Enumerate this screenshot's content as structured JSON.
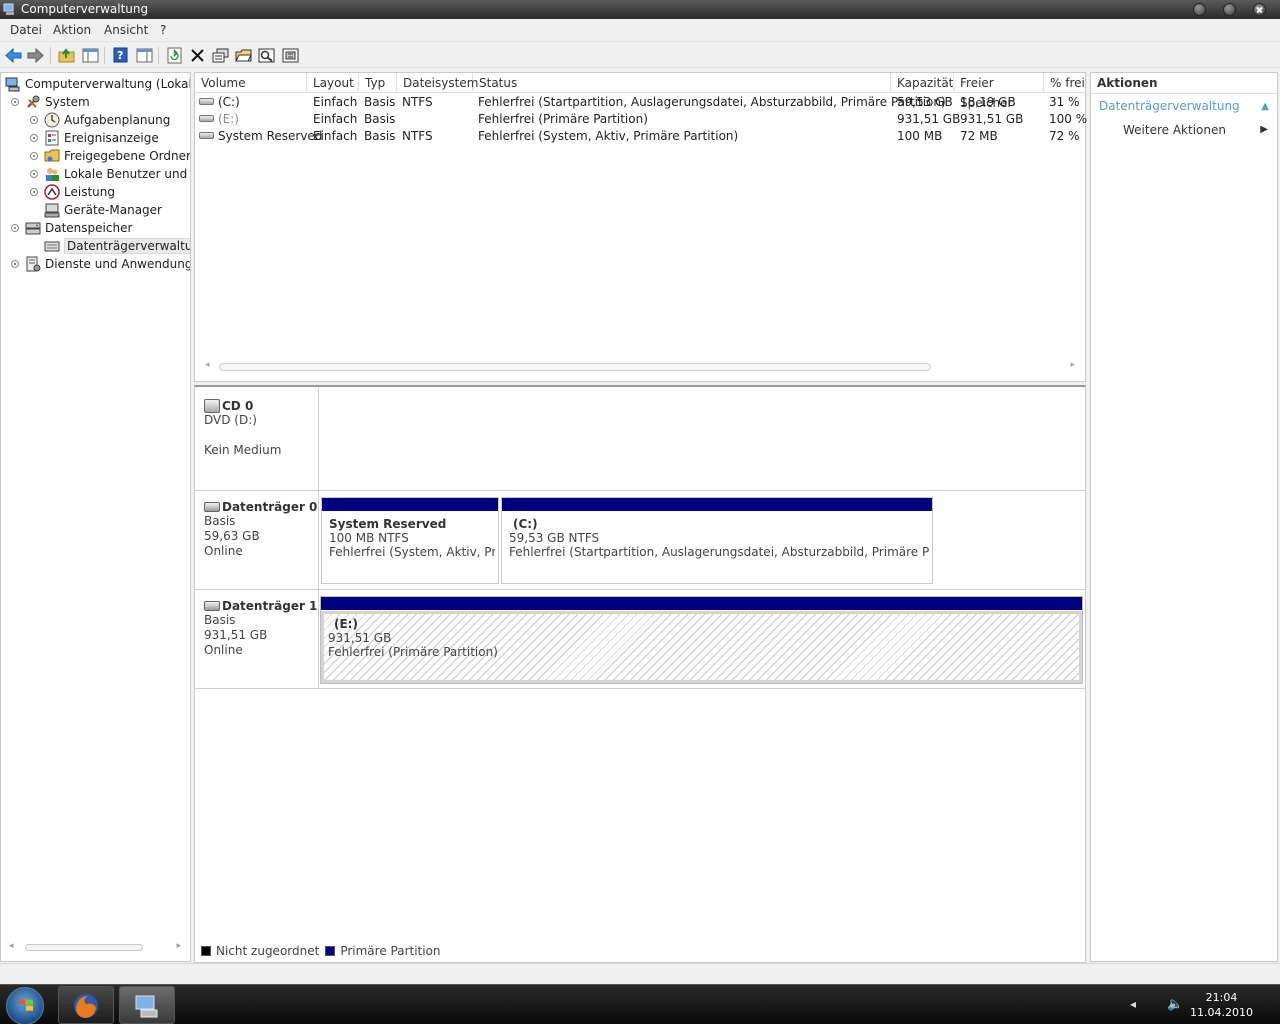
{
  "window": {
    "title": "Computerverwaltung"
  },
  "menu": [
    "Datei",
    "Aktion",
    "Ansicht",
    "?"
  ],
  "toolbar": {
    "buttons": [
      "back-icon",
      "forward-icon",
      "up-folder-icon",
      "show-hide-tree-icon",
      "help-icon",
      "properties-pane-icon",
      "refresh-icon",
      "delete-icon",
      "properties-icon",
      "open-icon",
      "search-icon",
      "export-icon"
    ]
  },
  "tree": {
    "root": "Computerverwaltung (Lokal)",
    "items": [
      {
        "label": "System",
        "level": 1,
        "icon": "tools-icon"
      },
      {
        "label": "Aufgabenplanung",
        "level": 2,
        "icon": "clock-icon"
      },
      {
        "label": "Ereignisanzeige",
        "level": 2,
        "icon": "event-viewer-icon"
      },
      {
        "label": "Freigegebene Ordner",
        "level": 2,
        "icon": "shared-folder-icon"
      },
      {
        "label": "Lokale Benutzer und Gruppen",
        "level": 2,
        "icon": "users-icon"
      },
      {
        "label": "Leistung",
        "level": 2,
        "icon": "performance-icon"
      },
      {
        "label": "Geräte-Manager",
        "level": 2,
        "icon": "device-manager-icon"
      },
      {
        "label": "Datenspeicher",
        "level": 1,
        "icon": "storage-icon"
      },
      {
        "label": "Datenträgerverwaltung",
        "level": 2,
        "icon": "disk-management-icon"
      },
      {
        "label": "Dienste und Anwendungen",
        "level": 1,
        "icon": "services-icon"
      }
    ]
  },
  "volumes": {
    "columns": [
      "Volume",
      "Layout",
      "Typ",
      "Dateisystem",
      "Status",
      "Kapazität",
      "Freier Speicher",
      "% frei"
    ],
    "rows": [
      [
        "(C:)",
        "Einfach",
        "Basis",
        "NTFS",
        "Fehlerfrei (Startpartition, Auslagerungsdatei, Absturzabbild, Primäre Partition)",
        "59,53 GB",
        "18,19 GB",
        "31 %"
      ],
      [
        "(E:)",
        "Einfach",
        "Basis",
        "",
        "Fehlerfrei (Primäre Partition)",
        "931,51 GB",
        "931,51 GB",
        "100 %"
      ],
      [
        "System Reserved",
        "Einfach",
        "Basis",
        "NTFS",
        "Fehlerfrei (System, Aktiv, Primäre Partition)",
        "100 MB",
        "72 MB",
        "72 %"
      ]
    ]
  },
  "disks": {
    "cd0": {
      "name": "CD 0",
      "type": "DVD (D:)",
      "status": "Kein Medium"
    },
    "disk0": {
      "name": "Datenträger 0",
      "type": "Basis",
      "size": "59,63 GB",
      "status": "Online",
      "partitions": [
        {
          "name": "System Reserved",
          "size": "100 MB NTFS",
          "status": "Fehlerfrei (System, Aktiv, Primä"
        },
        {
          "name": "(C:)",
          "size": "59,53 GB NTFS",
          "status": "Fehlerfrei (Startpartition, Auslagerungsdatei, Absturzabbild, Primäre Partition)"
        }
      ]
    },
    "disk1": {
      "name": "Datenträger 1",
      "type": "Basis",
      "size": "931,51 GB",
      "status": "Online",
      "partitions": [
        {
          "name": "(E:)",
          "size": "931,51 GB",
          "status": "Fehlerfrei (Primäre Partition)"
        }
      ]
    }
  },
  "legend": {
    "unallocated": "Nicht zugeordnet",
    "primary": "Primäre Partition",
    "unallocated_color": "#000000",
    "primary_color": "#00007f"
  },
  "actions": {
    "header": "Aktionen",
    "section": "Datenträgerverwaltung",
    "more": "Weitere Aktionen"
  },
  "taskbar": {
    "time": "21:04",
    "date": "11.04.2010"
  }
}
